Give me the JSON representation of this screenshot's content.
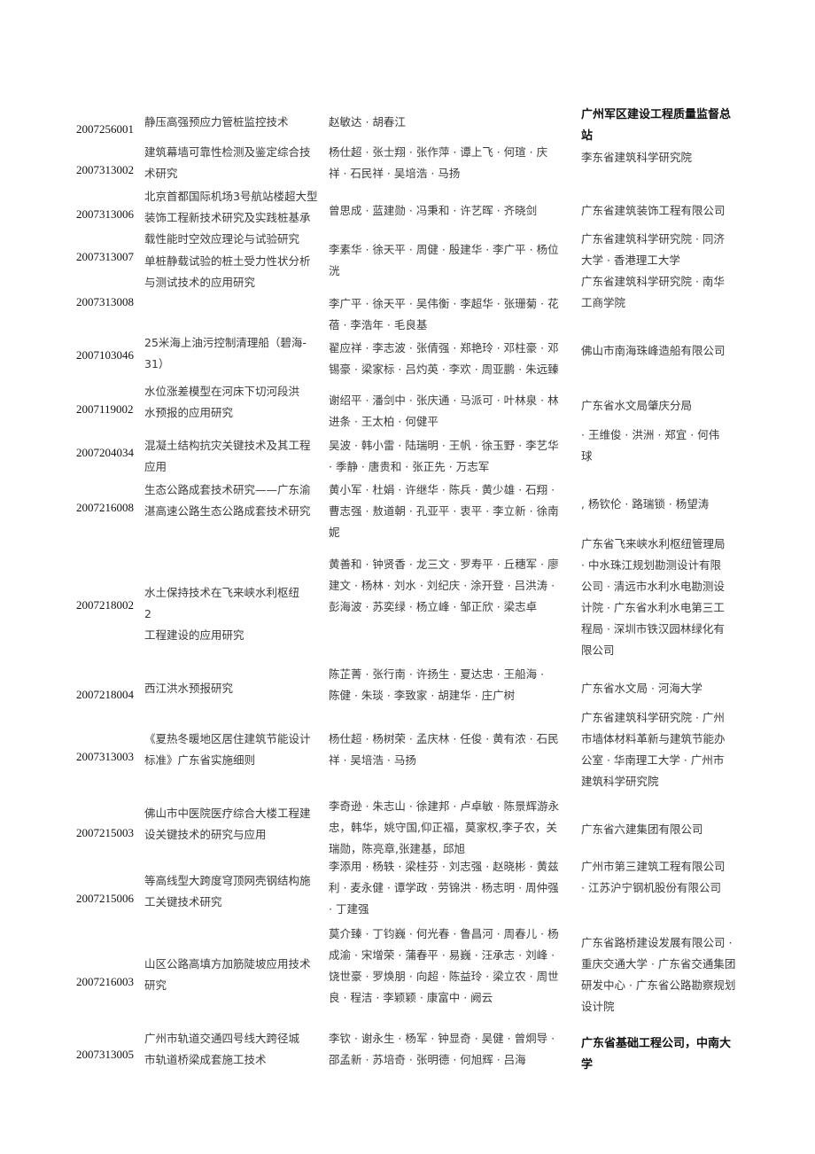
{
  "rows": [
    {
      "code": "2007256001",
      "title": [
        "静压高强预应力管桩监控技术"
      ],
      "people": [
        "赵敏达 · 胡春江"
      ],
      "org": [
        "广州军区建设工程质量监督总",
        "站"
      ]
    },
    {
      "code": "2007313002",
      "title": [
        "建筑幕墙可靠性检测及鉴定综合技",
        "术研究"
      ],
      "people": [
        "杨仕超 · 张士翔 · 张作萍 · 谭上飞 · 何瑄 · 庆",
        "祥 · 石民祥 · 吴培浩 · 马扬"
      ],
      "org": [
        "李东省建筑科学研究院"
      ]
    },
    {
      "code": "2007313006",
      "title": [
        "北京首都国际机场3号航站楼超大型",
        "装饰工程新技术研究及实践桩基承"
      ],
      "people": [
        "曾思成 · 蓝建勋 · 冯秉和 · 许艺晖 · 齐晓剑"
      ],
      "org": [
        "广东省建筑装饰工程有限公司"
      ]
    },
    {
      "code": "2007313007",
      "title": [
        "载性能时空效应理论与试验研究"
      ],
      "people": [
        "李素华 · 徐天平 · 周健 · 殷建华 · 李广平 · 杨位",
        "洸"
      ],
      "org": [
        "广东省建筑科学研究院 · 同济",
        "大学 · 香港理工大学"
      ]
    },
    {
      "code": "2007313008",
      "title": [
        "单桩静载试验的桩土受力性状分析",
        "与测试技术的应用研究"
      ],
      "people": [
        "李广平 · 徐天平 · 吴伟衡 · 李超华 · 张珊菊 · 花",
        "蓓 · 李浩年 · 毛良基"
      ],
      "org": [
        "广东省建筑科学研究院 · 南华",
        "工商学院"
      ]
    },
    {
      "code": "2007103046",
      "title": [
        "25米海上油污控制清理船（碧海-",
        "31）"
      ],
      "people": [
        "翟应祥 · 李志波 · 张倩强 · 郑艳玲 · 邓柱豪 · 邓",
        "锡豪 · 梁家标 · 吕灼英 · 李欢 · 周亚鹏 · 朱远臻"
      ],
      "org": [
        "佛山市南海珠峰造船有限公司"
      ]
    },
    {
      "code": "2007119002",
      "title": [
        "水位涨差模型在河床下切河段洪",
        "水预报的应用研究"
      ],
      "people": [
        "谢绍平 · 潘剑中 · 张庆通 · 马派可 · 叶林泉 · 林",
        "进条 · 王太柏 · 何健平"
      ],
      "org": [
        "广东省水文局肇庆分局"
      ]
    },
    {
      "code": "2007204034",
      "title": [
        "混凝土结构抗灾关键技术及其工程",
        "应用"
      ],
      "people": [
        "吴波 · 韩小雷 · 陆瑞明 · 王帆 · 徐玉野 · 李艺华",
        " · 季静 · 唐贵和 · 张正先 · 万志军"
      ],
      "org": [
        " · 王维俊 · 洪洲 · 郑宜 · 何伟",
        "球"
      ]
    },
    {
      "code": "2007216008",
      "title": [
        "生态公路成套技术研究——广东渝",
        "湛高速公路生态公路成套技术研究"
      ],
      "people": [
        "黄小军 · 杜娟 · 许继华 · 陈兵 · 黄少雄 · 石翔 ·",
        "曹志强 · 敖道朝 · 孔亚平 · 衷平 · 李立新 · 徐南",
        "妮"
      ],
      "org": [
        ", 杨钦伦 · 路瑞锁 · 杨望涛"
      ]
    },
    {
      "code": "2007218002",
      "title": [
        "水土保持技术在飞来峡水利枢纽",
        "2",
        "工程建设的应用研究"
      ],
      "people": [
        "黄善和 · 钟贤香 · 龙三文 · 罗寿平 · 丘穗军 · 廖",
        "建文 · 杨林 · 刘水 · 刘纪庆 · 涂开登 · 吕洪涛 ·",
        "彭海波 · 苏奕绿 · 杨立峰 · 邹正欣 · 梁志卓"
      ],
      "org": [
        "广东省飞来峡水利枢纽管理局",
        " · 中水珠江规划勘测设计有限",
        "公司 · 清远市水利水电勘测设",
        "计院 · 广东省水利水电第三工",
        "程局 · 深圳市铁汉园林绿化有",
        "限公司"
      ]
    },
    {
      "code": "2007218004",
      "title": [
        "西江洪水预报研究"
      ],
      "people": [
        "陈芷菁 · 张行南 · 许扬生 · 夏达忠 · 王船海 ·",
        "陈健 · 朱琰 · 李致家 · 胡建华 · 庄广树"
      ],
      "org": [
        "广东省水文局 · 河海大学"
      ]
    },
    {
      "code": "2007313003",
      "title": [
        "《夏热冬暖地区居住建筑节能设计",
        "标准》广东省实施细则"
      ],
      "people": [
        "杨仕超 · 杨树荣 · 孟庆林 · 任俊 · 黄有浓 · 石民",
        "祥 · 吴培浩 · 马扬"
      ],
      "org": [
        "广东省建筑科学研究院 · 广州",
        "市墙体材料革新与建筑节能办",
        "公室 · 华南理工大学 · 广州市",
        "建筑科学研究院"
      ]
    },
    {
      "code": "2007215003",
      "title": [
        "佛山市中医院医疗综合大楼工程建",
        "设关键技术的研究与应用"
      ],
      "people": [
        "李奇逊 · 朱志山 · 徐建邦 · 卢卓敏 · 陈景辉游永",
        "忠，韩华，姚守国,仰正福，莫家权,李子农，关",
        "瑞勋，陈亮章,张建基，邱旭"
      ],
      "org": [
        "广东省六建集团有限公司"
      ]
    },
    {
      "code": "2007215006",
      "title": [
        "等高线型大跨度穹顶网壳钢结构施",
        "工关键技术研究"
      ],
      "people": [
        "李添用 · 杨轶 · 梁桂芬 · 刘志强 · 赵晓彬 · 黄兹",
        "利 · 麦永健 · 谭学政 · 劳锦洪 · 杨志明 · 周仲强",
        " · 丁建强"
      ],
      "org": [
        "广州市第三建筑工程有限公司",
        " · 江苏沪宁钢机股份有限公司"
      ]
    },
    {
      "code": "2007216003",
      "title": [
        "山区公路高填方加筋陡坡应用技术",
        "研究"
      ],
      "people": [
        "莫介臻 · 丁钧巍 · 何光春 · 鲁昌河 · 周春儿 · 杨",
        "成渝 · 宋增荣 · 蒲春平 · 易巍 · 汪承志 · 刘峰 ·",
        "饶世豪 · 罗焕朋 · 向超 · 陈益玲 · 梁立农 · 周世",
        "良 · 程洁 · 李颖颖 · 康富中 · 阙云"
      ],
      "org": [
        "广东省路桥建设发展有限公司 ·",
        "重庆交通大学 · 广东省交通集团",
        "研发中心 · 广东省公路勘察规划",
        "设计院"
      ]
    },
    {
      "code": "2007313005",
      "title": [
        "广州市轨道交通四号线大跨径城",
        "市轨道桥梁成套施工技术"
      ],
      "people": [
        "李钦 · 谢永生 · 杨军 · 钟显奇 · 吴健 · 曾炯导 ·",
        "邵孟新 · 苏培奇 · 张明德 · 何旭辉 · 吕海"
      ],
      "org": [
        "广东省基础工程公司，中南大",
        "学"
      ]
    }
  ]
}
